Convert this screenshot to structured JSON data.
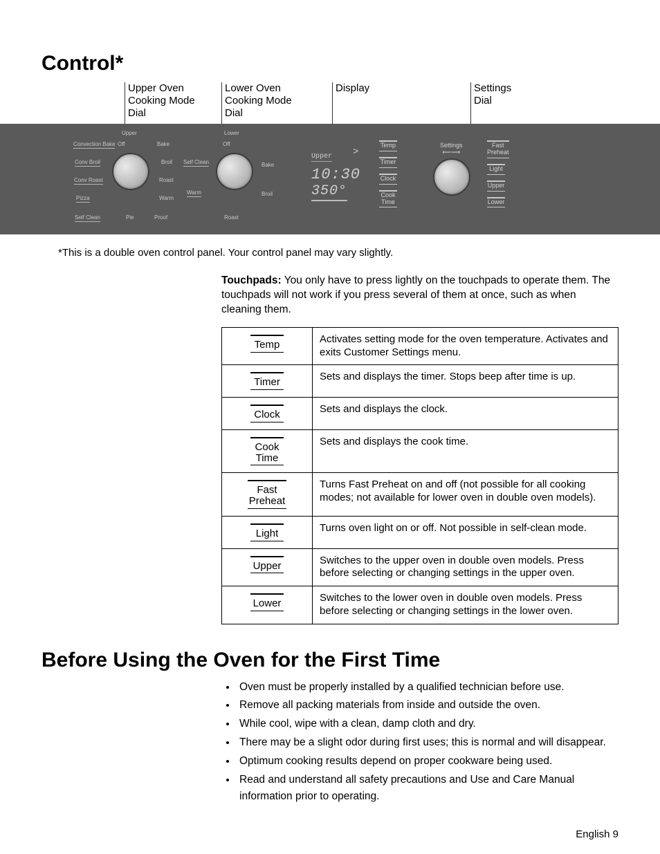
{
  "title": "Control*",
  "callouts": {
    "upper_dial": "Upper Oven\nCooking Mode\nDial",
    "lower_dial": "Lower Oven\nCooking Mode\nDial",
    "display": "Display",
    "settings_dial": "Settings\nDial"
  },
  "upper_dial_labels": {
    "upper": "Upper",
    "off": "Off",
    "bake": "Bake",
    "conv_bake": "Convection Bake",
    "broil": "Broil",
    "self_clean_r": "Self Clean",
    "conv_broil": "Conv Broil",
    "roast": "Roast",
    "conv_roast": "Conv Roast",
    "warm_r": "Warm",
    "warm_b": "Warm",
    "pizza": "Pizza",
    "proof": "Proof",
    "self_clean": "Self Clean",
    "pie": "Pie"
  },
  "lower_dial_labels": {
    "lower": "Lower",
    "off": "Off",
    "bake": "Bake",
    "broil": "Broil",
    "roast": "Roast"
  },
  "display": {
    "upper": "Upper",
    "arrow": ">",
    "time": "10:30",
    "temp": "350°"
  },
  "center_buttons": {
    "temp": "Temp",
    "timer": "Timer",
    "clock": "Clock",
    "cook_time": "Cook\nTime"
  },
  "settings_label": "Settings",
  "right_buttons": {
    "fast_preheat": "Fast\nPreheat",
    "light": "Light",
    "upper": "Upper",
    "lower": "Lower"
  },
  "note": "*This is a double oven control panel. Your control panel may vary slightly.",
  "intro_bold": "Touchpads:",
  "intro_rest": " You only have to press lightly on the touchpads to operate them. The touchpads will not work if you press several of them at once, such as when cleaning them.",
  "table": [
    {
      "label": "Temp",
      "desc": "Activates setting mode for the oven temperature. Activates and exits Customer Settings menu."
    },
    {
      "label": "Timer",
      "desc": "Sets and displays the timer. Stops beep after time is up."
    },
    {
      "label": "Clock",
      "desc": "Sets and displays the clock."
    },
    {
      "label": "Cook\nTime",
      "desc": "Sets and displays the cook time."
    },
    {
      "label": "Fast\nPreheat",
      "desc": "Turns Fast Preheat on and off (not possible for all cooking modes; not available for lower oven in double oven models)."
    },
    {
      "label": "Light",
      "desc": "Turns oven light on or off. Not possible in self-clean mode."
    },
    {
      "label": "Upper",
      "desc": "Switches to the upper oven in double oven models. Press before selecting or changing settings in the upper oven."
    },
    {
      "label": "Lower",
      "desc": "Switches to the lower oven in double oven models. Press before selecting or changing settings in the lower oven."
    }
  ],
  "h2": "Before Using the Oven for the First Time",
  "bullets": [
    "Oven must be properly installed by a qualified technician before use.",
    "Remove all packing materials from inside and outside the oven.",
    "While cool, wipe with a clean, damp cloth and dry.",
    "There may be a slight odor during first uses; this is normal and will disappear.",
    "Optimum cooking results depend on proper cookware being used.",
    "Read and understand all safety precautions and Use and Care Manual information prior to operating."
  ],
  "footer": "English 9"
}
